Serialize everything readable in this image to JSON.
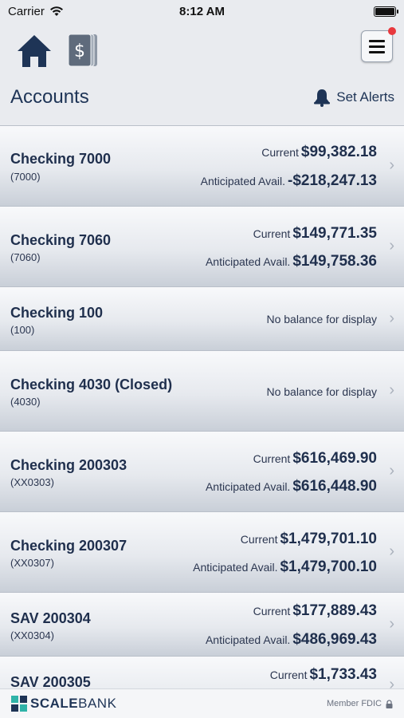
{
  "status_bar": {
    "carrier": "Carrier",
    "time": "8:12 AM"
  },
  "header": {
    "title": "Accounts",
    "alerts_label": "Set Alerts"
  },
  "accounts": [
    {
      "name": "Checking 7000",
      "number": "(7000)",
      "current_label": "Current",
      "current": "$99,382.18",
      "anticipated_label": "Anticipated Avail.",
      "anticipated": "-$218,247.13"
    },
    {
      "name": "Checking 7060",
      "number": "(7060)",
      "current_label": "Current",
      "current": "$149,771.35",
      "anticipated_label": "Anticipated Avail.",
      "anticipated": "$149,758.36"
    },
    {
      "name": "Checking 100",
      "number": "(100)",
      "no_balance": "No balance for display"
    },
    {
      "name": "Checking 4030 (Closed)",
      "number": "(4030)",
      "no_balance": "No balance for display"
    },
    {
      "name": "Checking 200303",
      "number": "(XX0303)",
      "current_label": "Current",
      "current": "$616,469.90",
      "anticipated_label": "Anticipated Avail.",
      "anticipated": "$616,448.90"
    },
    {
      "name": "Checking 200307",
      "number": "(XX0307)",
      "current_label": "Current",
      "current": "$1,479,701.10",
      "anticipated_label": "Anticipated Avail.",
      "anticipated": "$1,479,700.10"
    },
    {
      "name": "SAV 200304",
      "number": "(XX0304)",
      "current_label": "Current",
      "current": "$177,889.43",
      "anticipated_label": "Anticipated Avail.",
      "anticipated": "$486,969.43"
    },
    {
      "name": "SAV 200305",
      "current_label": "Current",
      "current": "$1,733.43"
    }
  ],
  "footer": {
    "brand_part1": "SCALE",
    "brand_part2": "BANK",
    "fdic": "Member FDIC"
  },
  "icons": {
    "home": "home-icon",
    "money": "dollar-card-icon",
    "menu": "hamburger-menu-icon",
    "bell": "bell-icon",
    "chevron": "chevron-right-icon",
    "lock": "lock-icon"
  },
  "colors": {
    "brand_navy": "#1e3456",
    "logo_teal": "#2fb3a8",
    "notification_red": "#e8383d"
  }
}
